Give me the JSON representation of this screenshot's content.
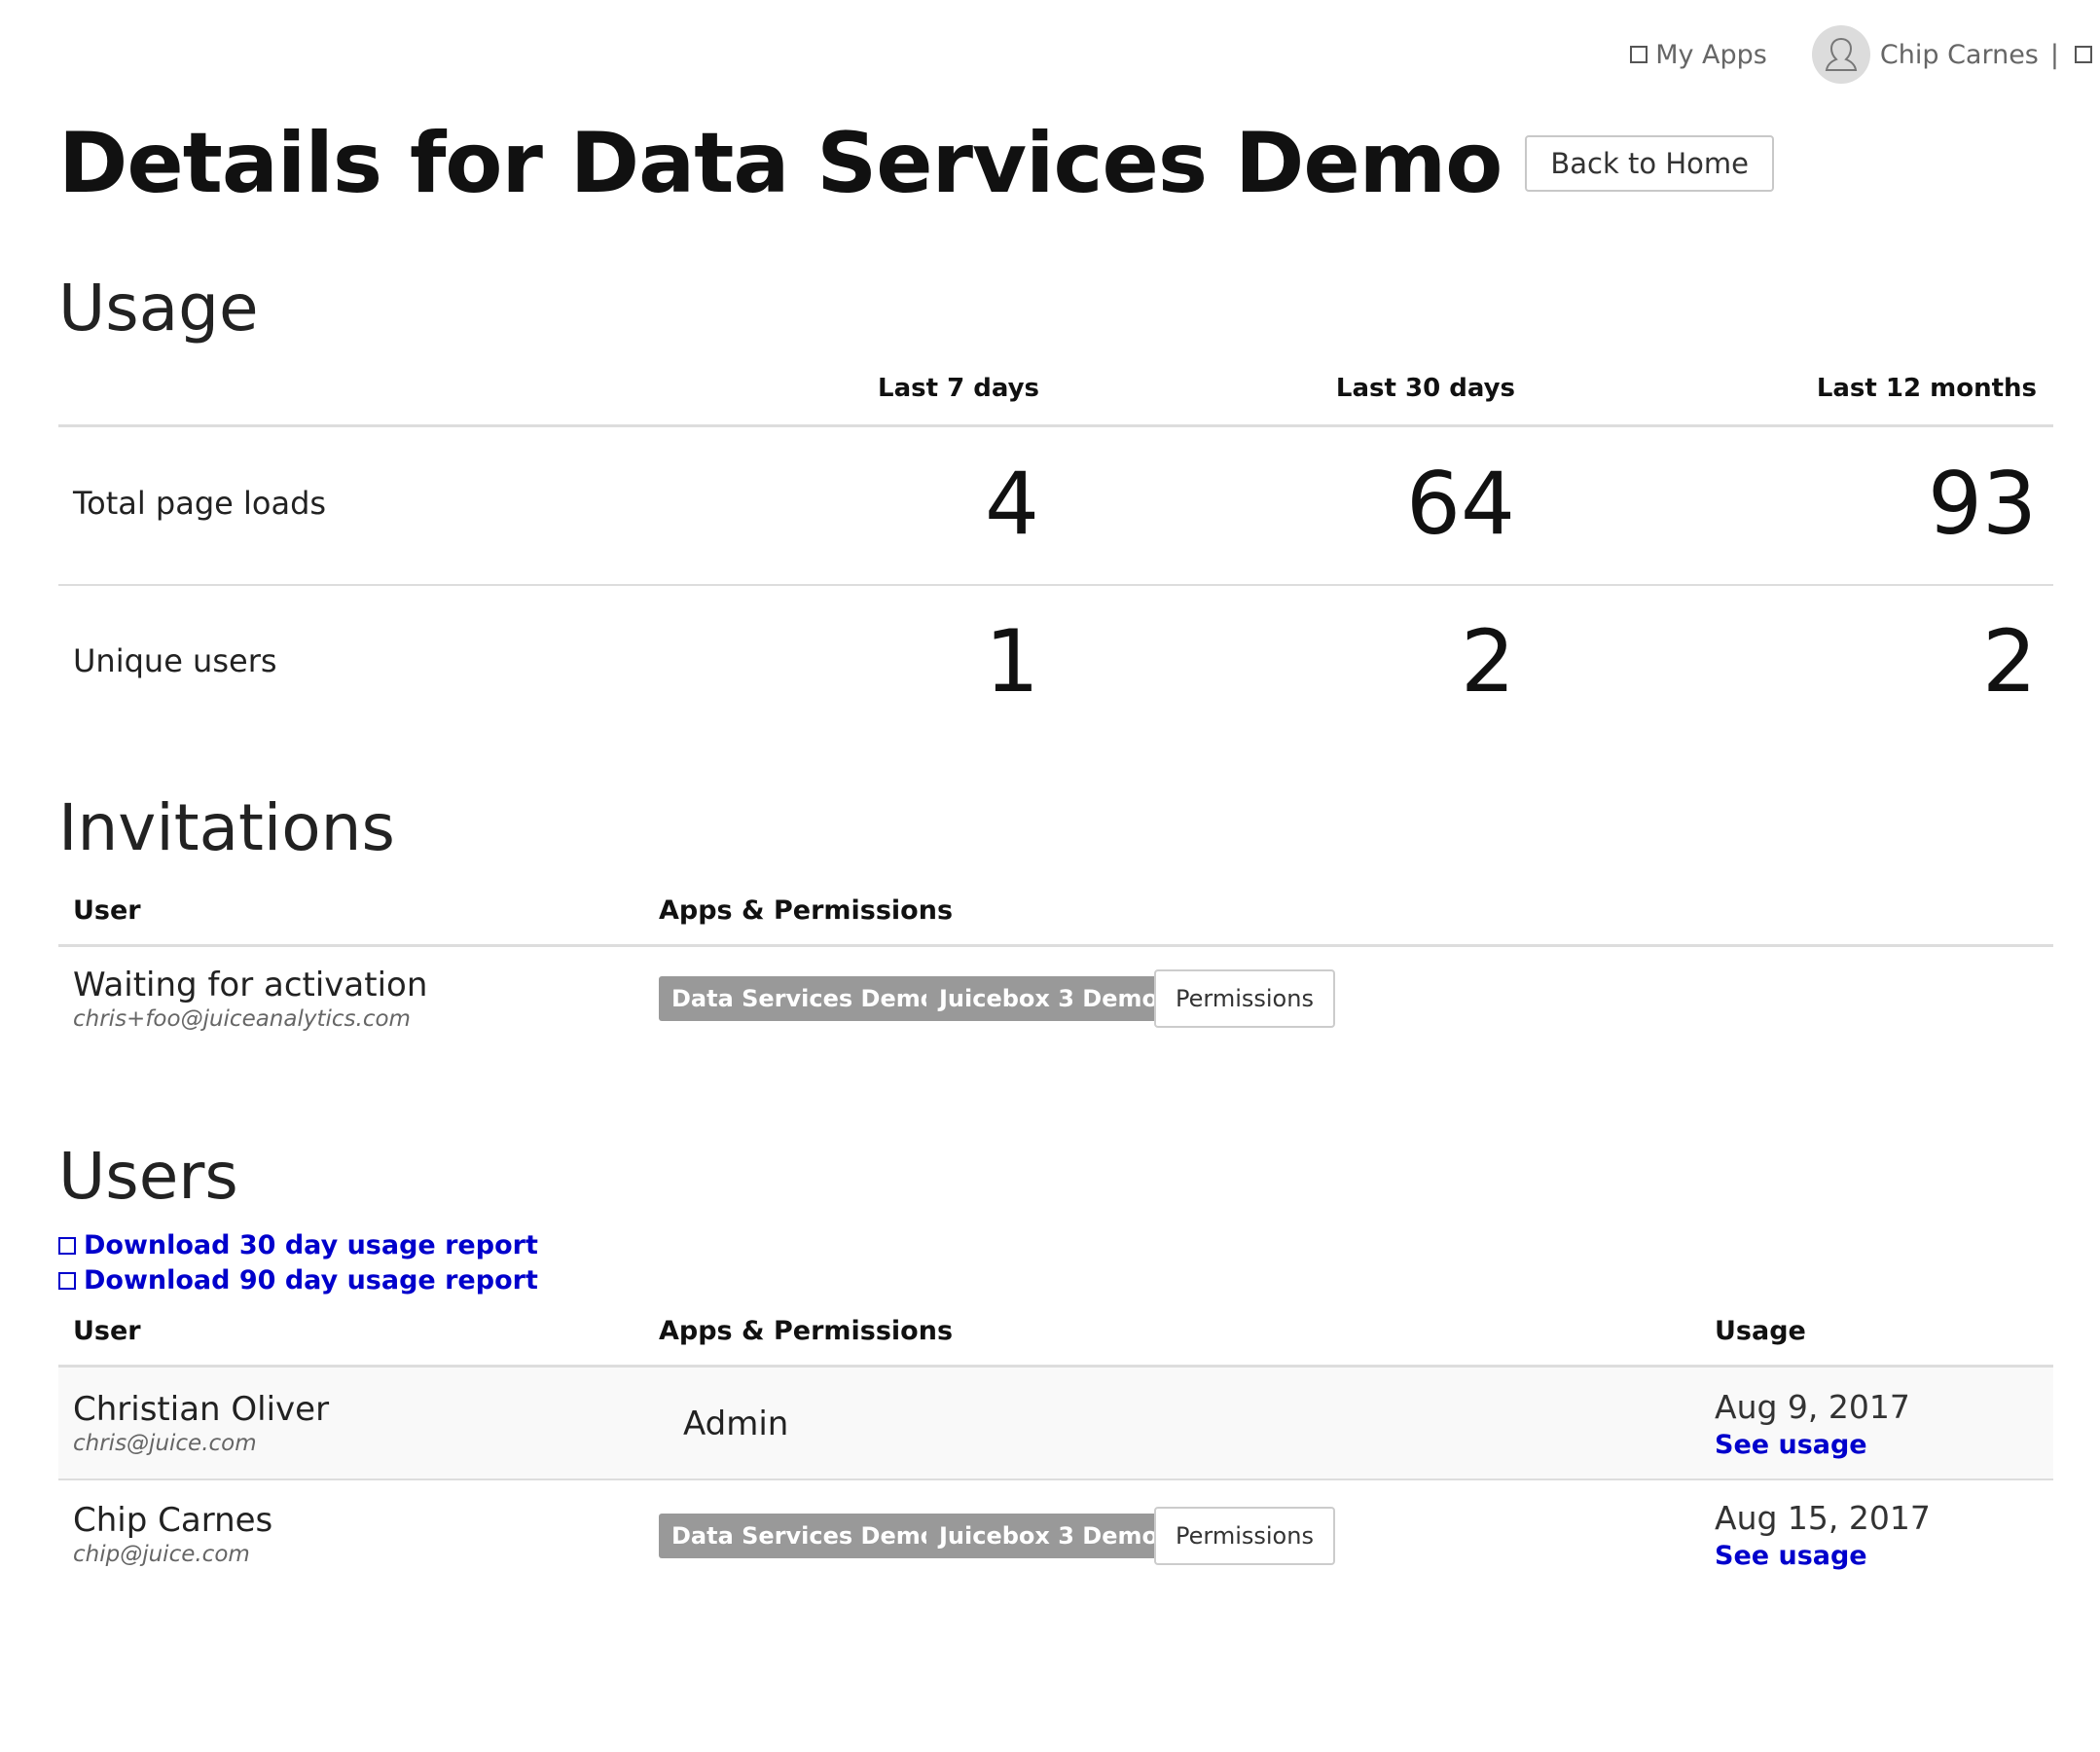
{
  "nav": {
    "my_apps": "My Apps",
    "user_name": "Chip Carnes",
    "separator": "|"
  },
  "page": {
    "title": "Details for Data Services Demo",
    "back_button": "Back to Home"
  },
  "usage": {
    "heading": "Usage",
    "columns": [
      "Last 7 days",
      "Last 30 days",
      "Last 12 months"
    ],
    "rows": [
      {
        "label": "Total page loads",
        "values": [
          "4",
          "64",
          "93"
        ]
      },
      {
        "label": "Unique users",
        "values": [
          "1",
          "2",
          "2"
        ]
      }
    ]
  },
  "invitations": {
    "heading": "Invitations",
    "col_user": "User",
    "col_apps": "Apps & Permissions",
    "rows": [
      {
        "name": "Waiting for activation",
        "email": "chris+foo@juiceanalytics.com",
        "apps": [
          "Data Services Demo",
          "Juicebox 3 Demo"
        ],
        "permissions_button": "Permissions"
      }
    ]
  },
  "users": {
    "heading": "Users",
    "download_30": "Download 30 day usage report",
    "download_90": "Download 90 day usage report",
    "col_user": "User",
    "col_apps": "Apps & Permissions",
    "col_usage": "Usage",
    "rows": [
      {
        "name": "Christian Oliver",
        "email": "chris@juice.com",
        "role": "Admin",
        "date": "Aug 9, 2017",
        "see_usage": "See usage"
      },
      {
        "name": "Chip Carnes",
        "email": "chip@juice.com",
        "apps": [
          "Data Services Demo",
          "Juicebox 3 Demo"
        ],
        "permissions_button": "Permissions",
        "date": "Aug 15, 2017",
        "see_usage": "See usage"
      }
    ]
  },
  "icons": {
    "square": "square-icon",
    "avatar": "user-avatar-icon"
  },
  "colors": {
    "link": "#0000cc",
    "badge": "#999999",
    "divider": "#dddddd"
  }
}
